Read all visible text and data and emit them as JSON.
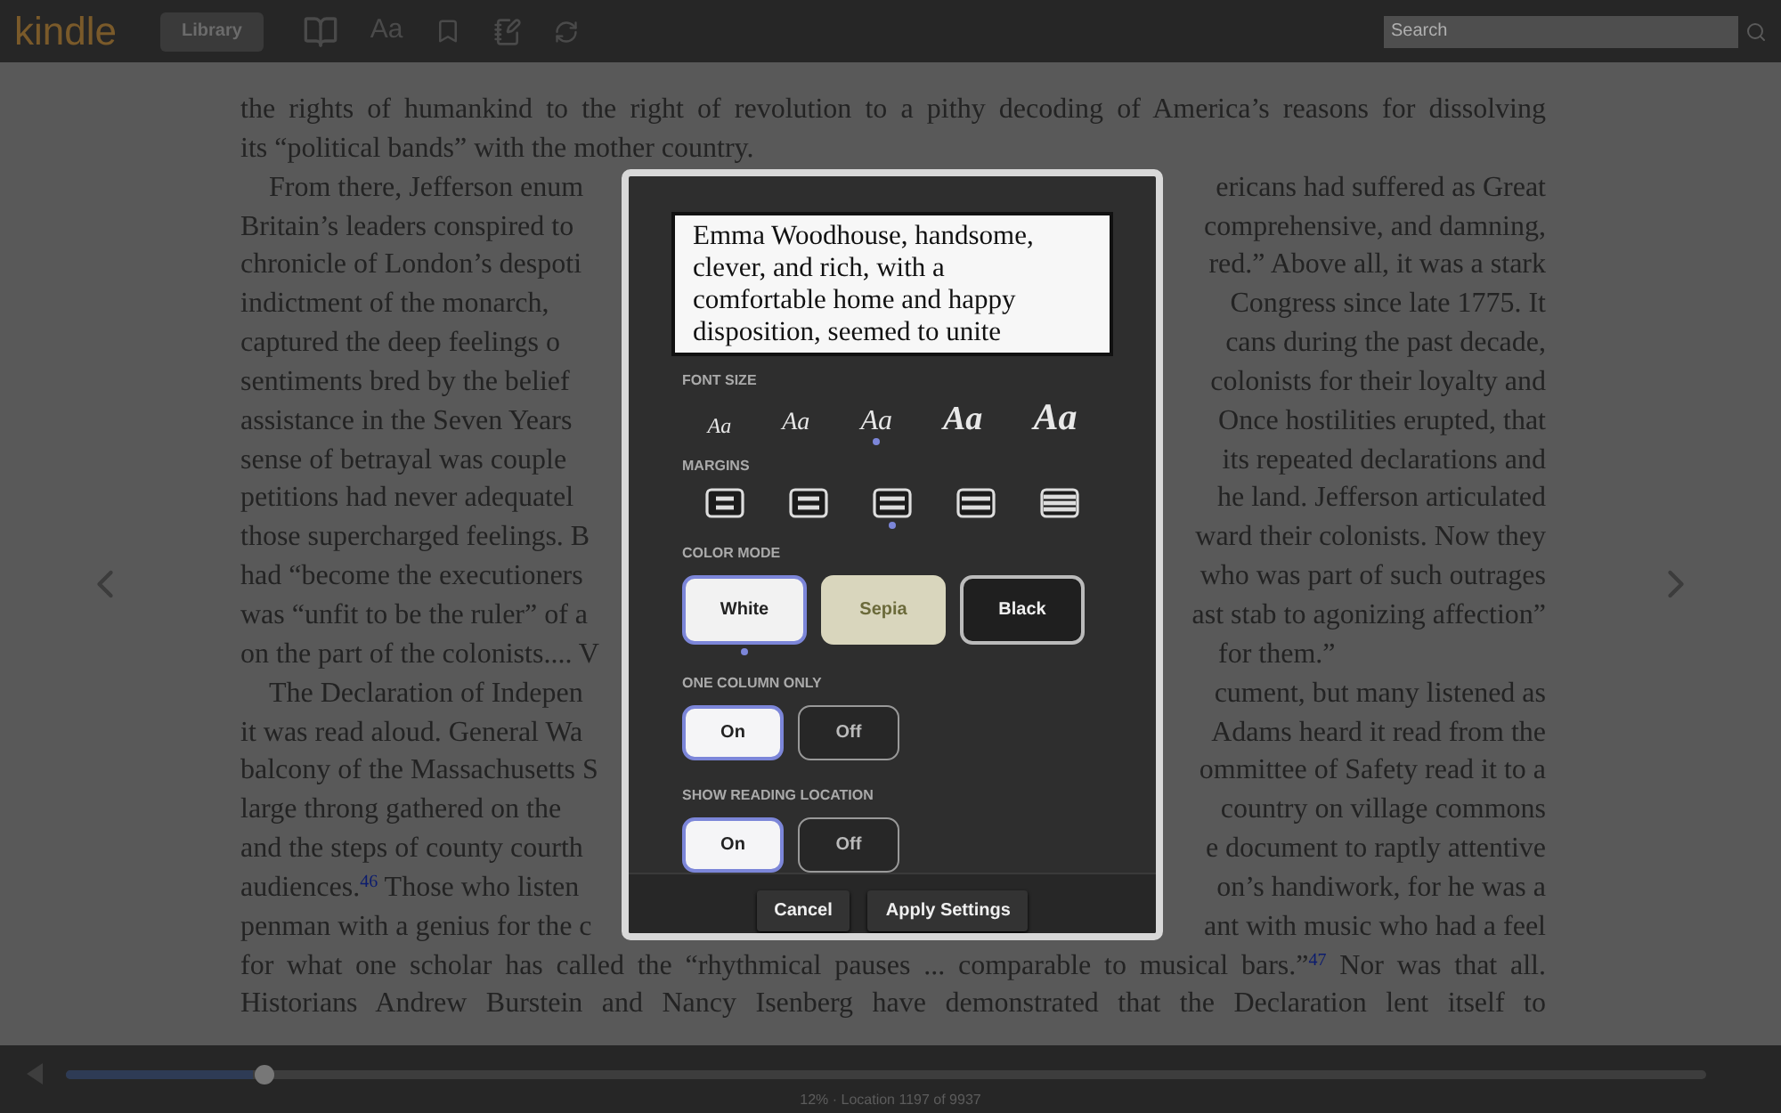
{
  "toolbar": {
    "logo": "kindle",
    "library_button": "Library",
    "font_button": "Aa",
    "search": {
      "placeholder": "Search"
    }
  },
  "page": {
    "paragraphs": [
      {
        "indented": false,
        "ends": true,
        "lines": [
          {
            "text": "the rights of humankind to the right of revolution to a pithy decoding of America’s reasons for dissolving"
          },
          {
            "text": "its “political bands” with the mother country."
          }
        ]
      },
      {
        "indented": true,
        "ends": true,
        "lines": [
          {
            "left": "From there, Jefferson enum",
            "right": "ericans had suffered as Great"
          },
          {
            "left": "Britain’s leaders conspired to",
            "right": "comprehensive, and damning,"
          },
          {
            "left": "chronicle of London’s despoti",
            "right": "red.” Above all, it was a stark"
          },
          {
            "left": "indictment of the monarch,",
            "right": "Congress since late 1775. It"
          },
          {
            "left": "captured the deep feelings o",
            "right": "cans during the past decade,"
          },
          {
            "left": "sentiments bred by the belief",
            "right": "colonists for their loyalty and"
          },
          {
            "left": "assistance in the Seven Years",
            "right": "Once hostilities erupted, that"
          },
          {
            "left": "sense of betrayal was couple",
            "right": "its repeated declarations and"
          },
          {
            "left": "petitions had never adequatel",
            "right": "he land. Jefferson articulated"
          },
          {
            "left": "those supercharged feelings. B",
            "right": "ward their colonists. Now they"
          },
          {
            "left": "had “become the executioners",
            "right": "who was part of such outrages"
          },
          {
            "left": "was “unfit to be the ruler” of a",
            "right": "ast stab to agonizing affection”"
          },
          {
            "left": "on the part of the colonists.... V",
            "right": "for them.”"
          }
        ]
      },
      {
        "indented": true,
        "ends": false,
        "lines": [
          {
            "left": "The Declaration of Indepen",
            "right": "cument, but many listened as"
          },
          {
            "left": "it was read aloud. General Wa",
            "right": "Adams heard it read from the"
          },
          {
            "left": "balcony of the Massachusetts S",
            "right": "ommittee of Safety read it to a"
          },
          {
            "left": "large throng gathered on the",
            "right": "country on village commons"
          },
          {
            "left": "and the steps of county courth",
            "right": "e document to raptly attentive"
          },
          {
            "left": "audiences.$^{46}$ Those who listen",
            "right": "on’s handiwork, for he was a"
          },
          {
            "left": "penman with a genius for the c",
            "right": "ant with music who had a feel"
          },
          {
            "text": "for what one scholar has called the “rhythmical pauses ... comparable to musical bars.”$^{47}$ Nor was that all."
          },
          {
            "text": "Historians Andrew Burstein and Nancy Isenberg have demonstrated that the Declaration lent itself to"
          }
        ]
      }
    ]
  },
  "settings_dialog": {
    "preview_lines": [
      "Emma Woodhouse, handsome,",
      "clever, and rich, with a",
      "comfortable home and happy",
      "disposition, seemed to unite"
    ],
    "font_size": {
      "label": "FONT SIZE",
      "options": [
        {
          "label": "Aa",
          "selected": false
        },
        {
          "label": "Aa",
          "selected": false
        },
        {
          "label": "Aa",
          "selected": true
        },
        {
          "label": "Aa",
          "selected": false
        },
        {
          "label": "Aa",
          "selected": false
        }
      ]
    },
    "margins": {
      "label": "MARGINS",
      "options": [
        {
          "selected": false
        },
        {
          "selected": false
        },
        {
          "selected": true
        },
        {
          "selected": false
        },
        {
          "selected": false
        }
      ]
    },
    "color_mode": {
      "label": "COLOR MODE",
      "options": [
        {
          "label": "White",
          "color": "#f2f2f2",
          "selected": true
        },
        {
          "label": "Sepia",
          "color": "#d9d6bd",
          "selected": false
        },
        {
          "label": "Black",
          "color": "#1f1f1f",
          "selected": false
        }
      ]
    },
    "one_column_only": {
      "label": "ONE COLUMN ONLY",
      "options": [
        {
          "label": "On",
          "selected": true
        },
        {
          "label": "Off",
          "selected": false
        }
      ]
    },
    "show_reading_location": {
      "label": "SHOW READING LOCATION",
      "options": [
        {
          "label": "On",
          "selected": true
        },
        {
          "label": "Off",
          "selected": false
        }
      ]
    },
    "buttons": [
      "Cancel",
      "Apply Settings"
    ]
  },
  "progress": {
    "level": 0.12,
    "text": "12% · Location 1197 of 9937"
  }
}
